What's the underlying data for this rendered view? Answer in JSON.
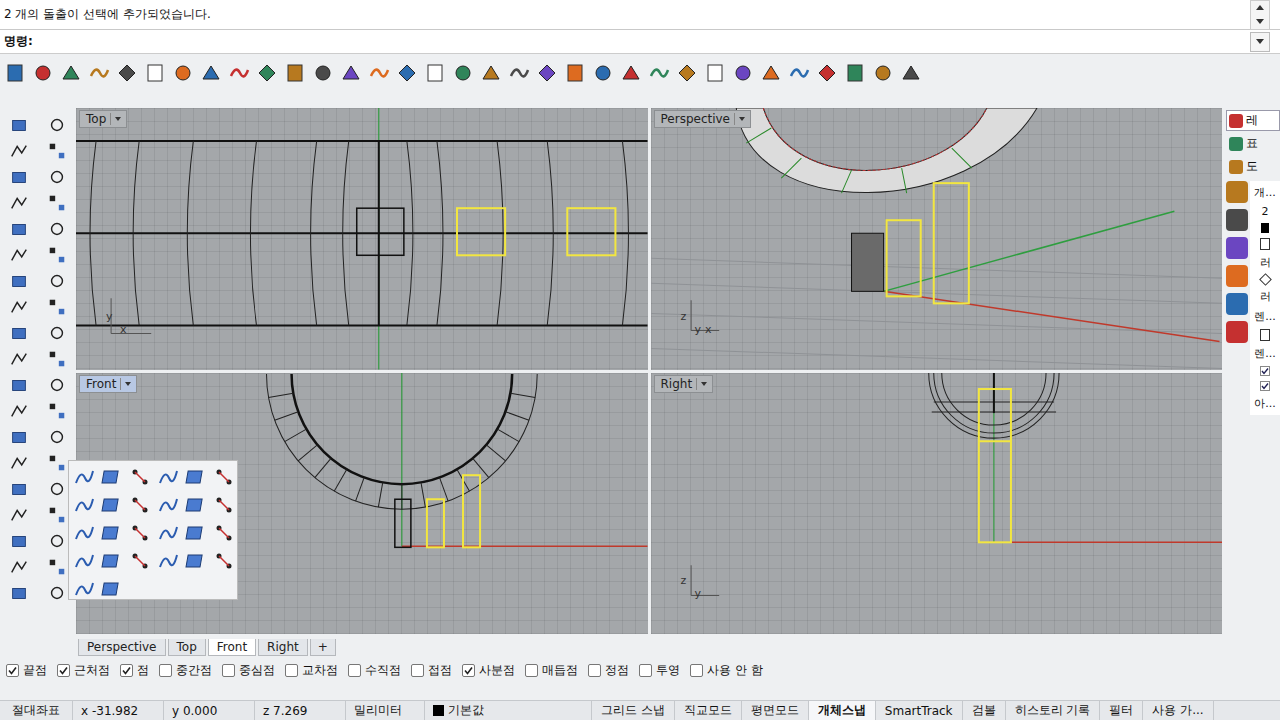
{
  "command": {
    "history": "2 개의 돌출이 선택에 추가되었습니다.",
    "prompt": "명령:"
  },
  "viewports": [
    {
      "label": "Top",
      "active": false,
      "axes": [
        "y",
        "x"
      ]
    },
    {
      "label": "Perspective",
      "active": false,
      "axes": [
        "z",
        "y",
        "x"
      ]
    },
    {
      "label": "Front",
      "active": true,
      "axes": [
        "z",
        "x"
      ]
    },
    {
      "label": "Right",
      "active": false,
      "axes": [
        "z",
        "y"
      ]
    }
  ],
  "view_tabs": [
    {
      "label": "Perspective",
      "selected": false
    },
    {
      "label": "Top",
      "selected": false
    },
    {
      "label": "Front",
      "selected": true
    },
    {
      "label": "Right",
      "selected": false
    }
  ],
  "add_tab": "+",
  "right_panel": {
    "tabs": [
      {
        "label": "레",
        "selected": true
      },
      {
        "label": "표",
        "selected": false
      },
      {
        "label": "도",
        "selected": false
      }
    ],
    "items": [
      {
        "kind": "text",
        "label": "개..."
      },
      {
        "kind": "text",
        "label": "2"
      },
      {
        "kind": "swatch"
      },
      {
        "kind": "box"
      },
      {
        "kind": "text",
        "label": "러"
      },
      {
        "kind": "diamond"
      },
      {
        "kind": "text",
        "label": "러"
      },
      {
        "kind": "text",
        "label": "렌..."
      },
      {
        "kind": "box"
      },
      {
        "kind": "text",
        "label": "렌..."
      },
      {
        "kind": "check",
        "checked": true
      },
      {
        "kind": "check",
        "checked": true
      },
      {
        "kind": "text",
        "label": "아..."
      }
    ]
  },
  "osnaps": [
    {
      "label": "끝점",
      "checked": true
    },
    {
      "label": "근처점",
      "checked": true
    },
    {
      "label": "점",
      "checked": true
    },
    {
      "label": "중간점",
      "checked": false
    },
    {
      "label": "중심점",
      "checked": false
    },
    {
      "label": "교차점",
      "checked": false
    },
    {
      "label": "수직점",
      "checked": false
    },
    {
      "label": "접점",
      "checked": false
    },
    {
      "label": "사분점",
      "checked": true
    },
    {
      "label": "매듭점",
      "checked": false
    },
    {
      "label": "정점",
      "checked": false
    },
    {
      "label": "투영",
      "checked": false
    },
    {
      "label": "사용 안 함",
      "checked": false
    }
  ],
  "status_bar": {
    "coord_system": "절대좌표",
    "coords": [
      "x -31.982",
      "y 0.000",
      "z 7.269"
    ],
    "units": "밀리미터",
    "layer": "기본값",
    "toggles": [
      {
        "label": "그리드 스냅",
        "on": false
      },
      {
        "label": "직교모드",
        "on": false
      },
      {
        "label": "평면모드",
        "on": false
      },
      {
        "label": "개체스냅",
        "on": true
      },
      {
        "label": "SmartTrack",
        "on": false
      },
      {
        "label": "검볼",
        "on": false
      },
      {
        "label": "히스토리 기록",
        "on": false
      },
      {
        "label": "필터",
        "on": false
      },
      {
        "label": "사용 가...",
        "on": false
      }
    ]
  }
}
